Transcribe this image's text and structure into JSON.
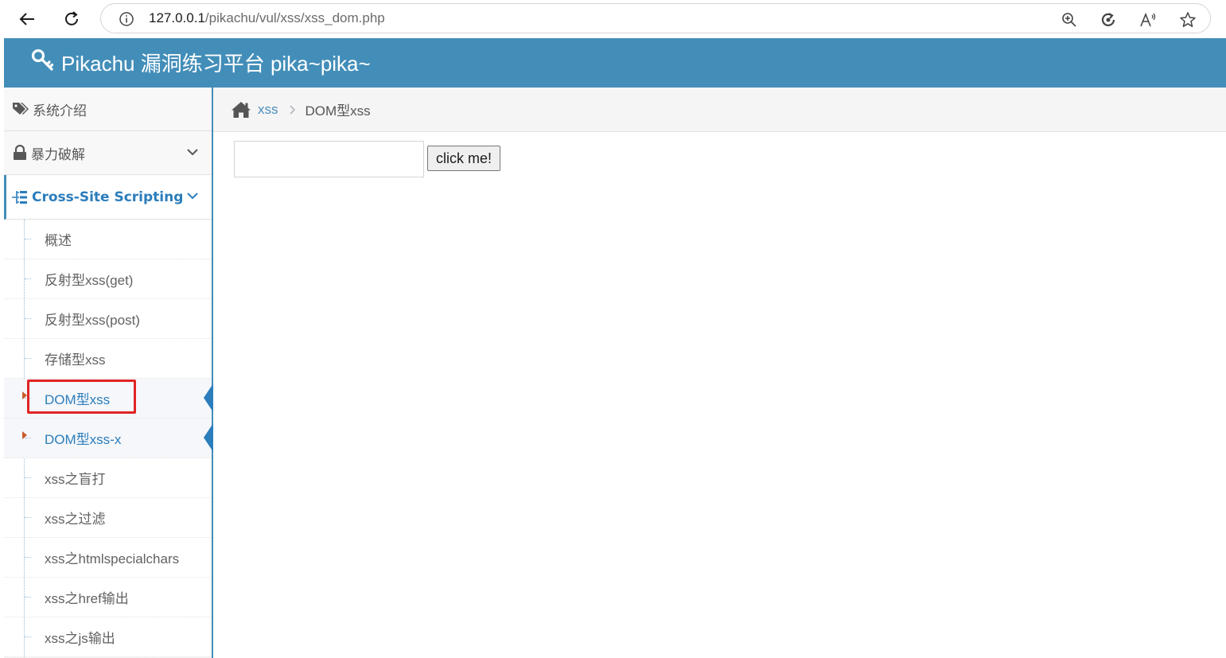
{
  "browser": {
    "url_host": "127.0.0.1",
    "url_path": "/pikachu/vul/xss/xss_dom.php",
    "icons": [
      "back-arrow-icon",
      "refresh-icon",
      "info-icon",
      "zoom-icon",
      "edge-refresh-icon",
      "read-aloud-icon",
      "favorite-star-icon"
    ]
  },
  "header": {
    "title": "Pikachu 漏洞练习平台 pika~pika~",
    "icon": "key-icon",
    "bg_color": "#438eb9"
  },
  "sidebar": {
    "top_items": [
      {
        "label": "系统介绍",
        "icon": "tags-icon"
      },
      {
        "label": "暴力破解",
        "icon": "lock-icon"
      },
      {
        "label": "Cross-Site Scripting",
        "icon": "list-icon"
      }
    ],
    "sub_items": [
      {
        "label": "概述"
      },
      {
        "label": "反射型xss(get)"
      },
      {
        "label": "反射型xss(post)"
      },
      {
        "label": "存储型xss"
      },
      {
        "label": "DOM型xss"
      },
      {
        "label": "DOM型xss-x"
      },
      {
        "label": "xss之盲打"
      },
      {
        "label": "xss之过滤"
      },
      {
        "label": "xss之htmlspecialchars"
      },
      {
        "label": "xss之href输出"
      },
      {
        "label": "xss之js输出"
      }
    ],
    "accent_color": "#2b7dbc"
  },
  "breadcrumb": {
    "home_icon": "home-icon",
    "link": "xss",
    "current": "DOM型xss"
  },
  "form": {
    "input_value": "",
    "button_label": "click me!"
  }
}
